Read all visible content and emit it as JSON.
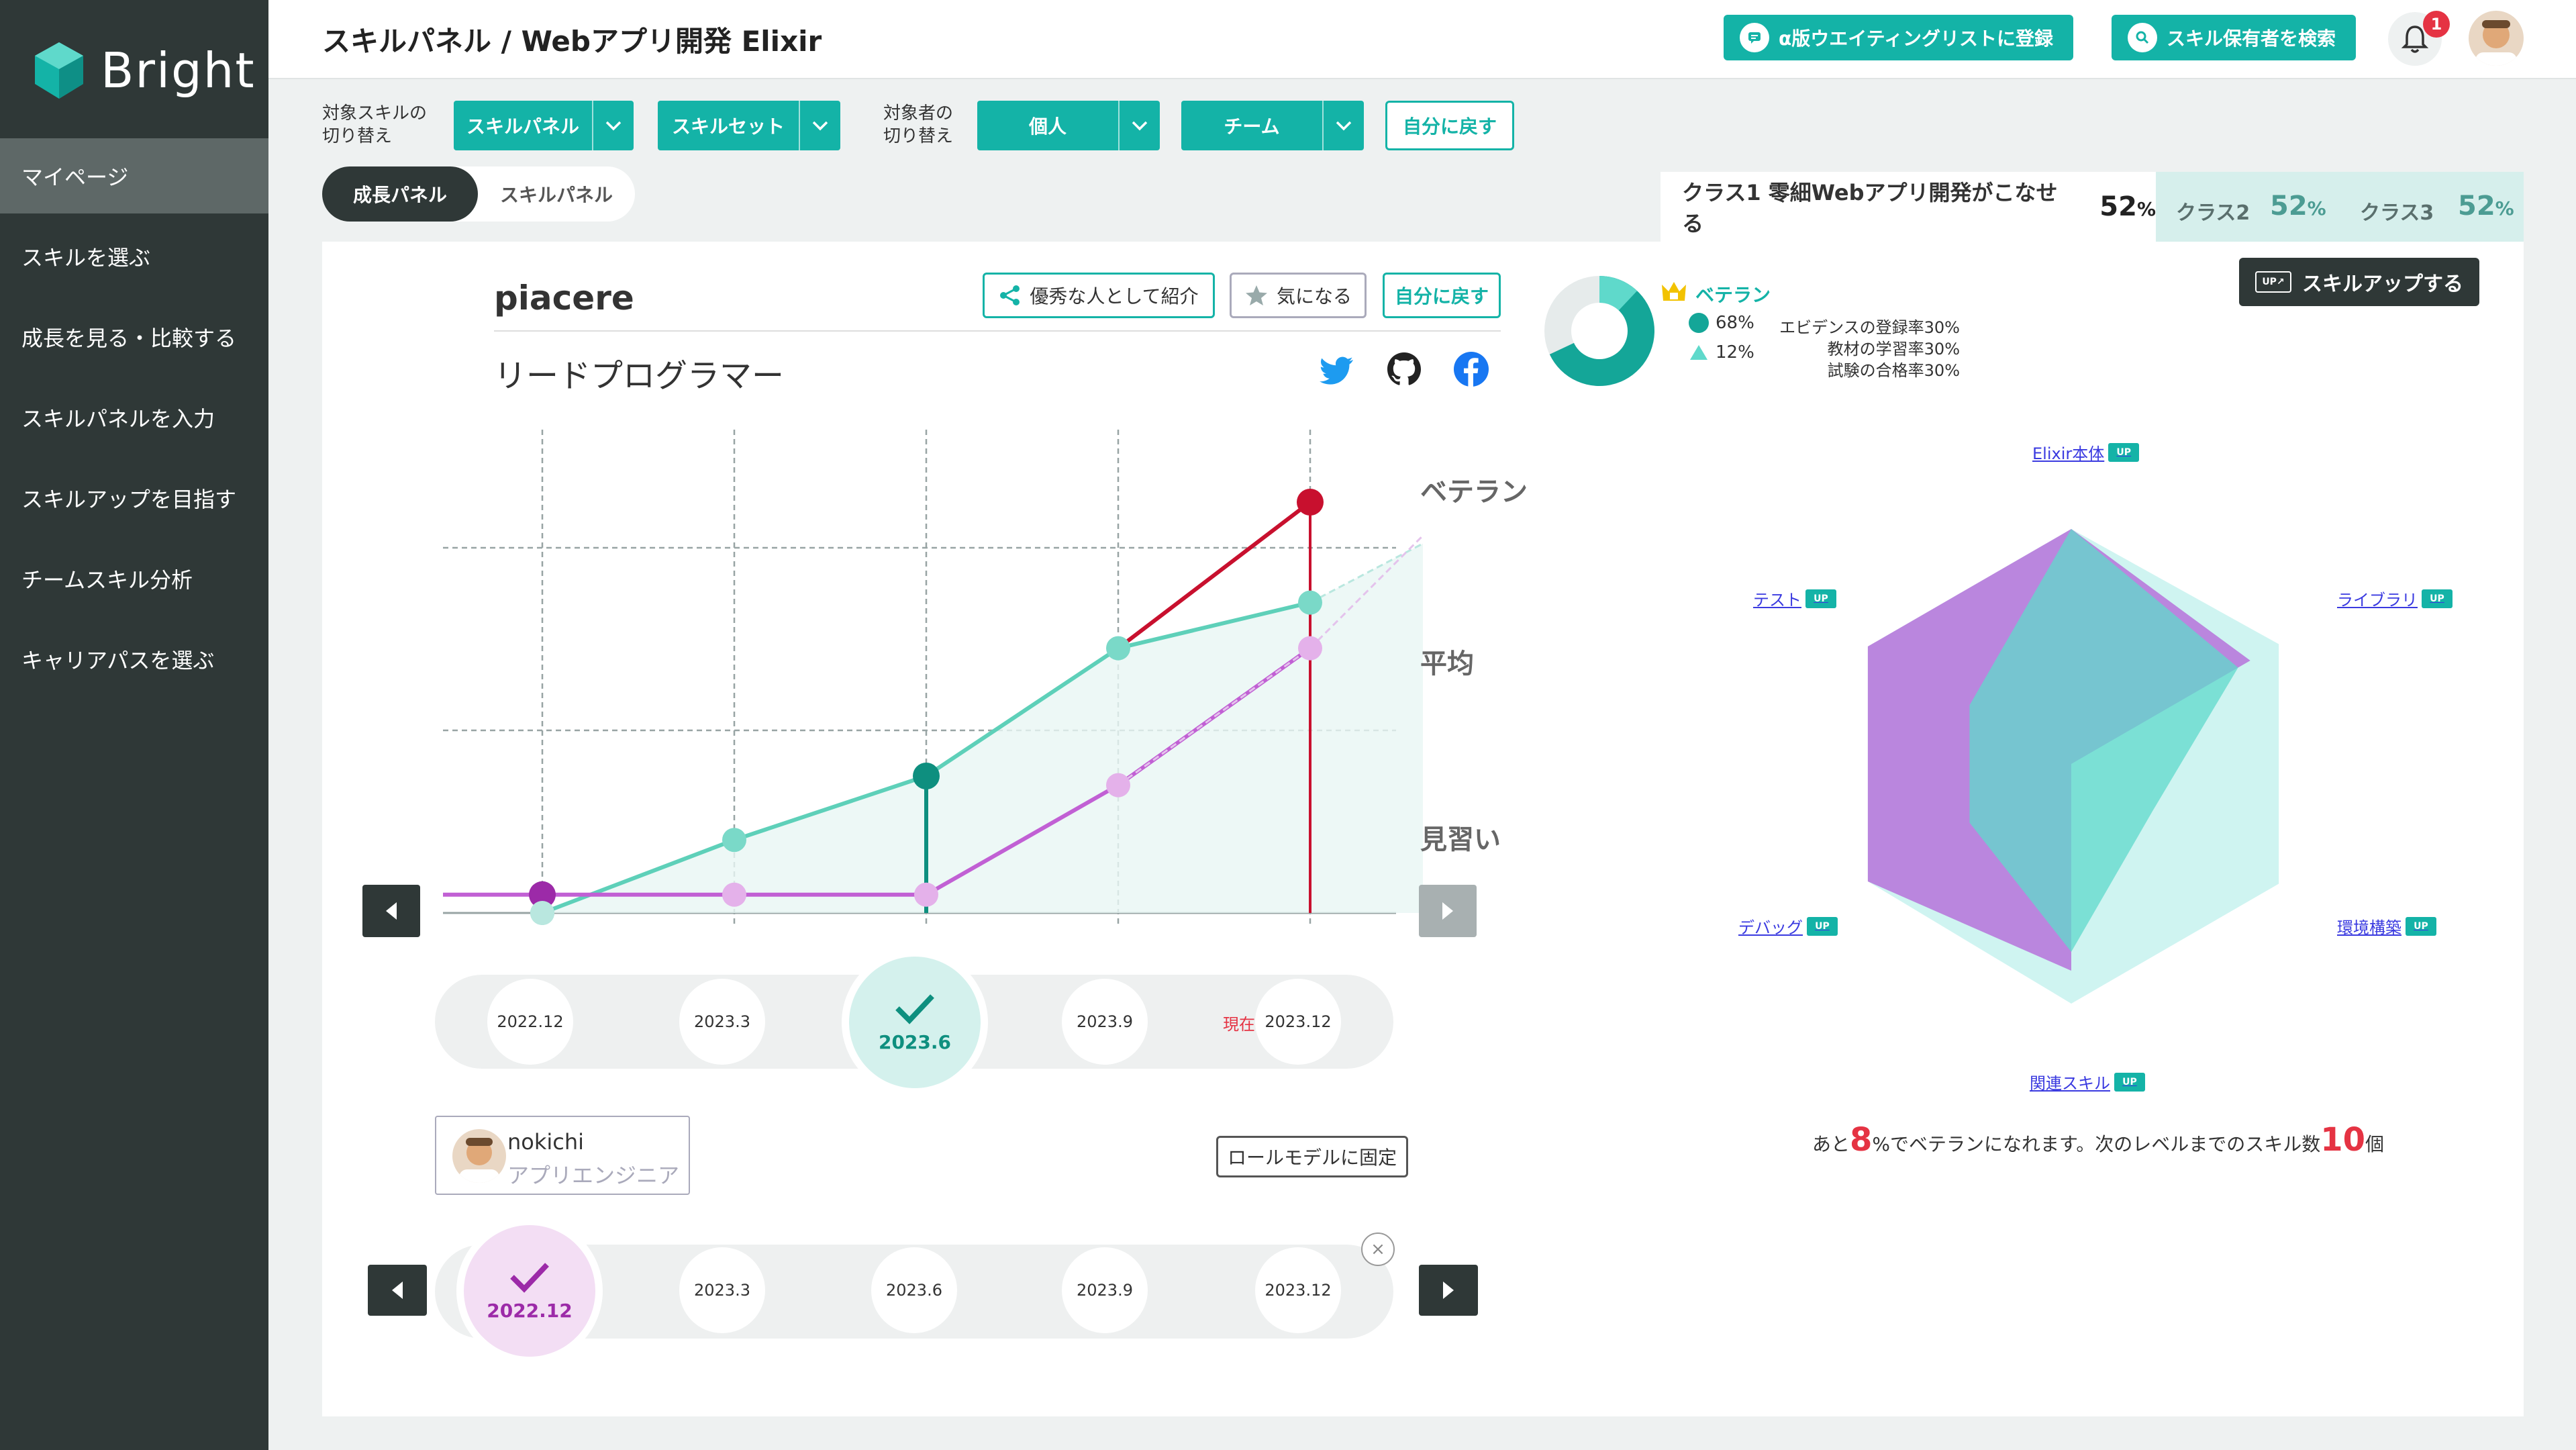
{
  "brand": {
    "logo_text": "Bright"
  },
  "sidebar": {
    "items": [
      {
        "label": "マイページ",
        "active": true
      },
      {
        "label": "スキルを選ぶ"
      },
      {
        "label": "成長を見る・比較する"
      },
      {
        "label": "スキルパネルを入力"
      },
      {
        "label": "スキルアップを目指す"
      },
      {
        "label": "チームスキル分析"
      },
      {
        "label": "キャリアパスを選ぶ"
      }
    ]
  },
  "header": {
    "title": "スキルパネル / Webアプリ開発 Elixir",
    "waitlist_button": "α版ウエイティングリストに登録",
    "search_button": "スキル保有者を検索",
    "notification_count": "1"
  },
  "filters": {
    "skill_switch_label_1": "対象スキルの",
    "skill_switch_label_2": "切り替え",
    "skill_panel_dropdown": "スキルパネル",
    "skill_set_dropdown": "スキルセット",
    "target_label_1": "対象者の",
    "target_label_2": "切り替え",
    "individual_dropdown": "個人",
    "team_dropdown": "チーム",
    "back_to_self": "自分に戻す"
  },
  "toggle": {
    "growth_panel": "成長パネル",
    "skill_panel": "スキルパネル"
  },
  "class_tabs": [
    {
      "label": "クラス1 零細Webアプリ開発がこなせる",
      "pct": "52",
      "unit": "%"
    },
    {
      "label": "クラス2",
      "pct": "52",
      "unit": "%"
    },
    {
      "label": "クラス3",
      "pct": "52",
      "unit": "%"
    }
  ],
  "profile": {
    "name": "piacere",
    "role": "リードプログラマー",
    "introduce_button": "優秀な人として紹介",
    "interested_button": "気になる",
    "back_to_self": "自分に戻す"
  },
  "social_icons": [
    "twitter-icon",
    "github-icon",
    "facebook-icon"
  ],
  "growth_levels": [
    "ベテラン",
    "平均",
    "見習い"
  ],
  "growth_chart_data": {
    "type": "line",
    "x": [
      "2022.12",
      "2023.3",
      "2023.6",
      "2023.9",
      "2023.12",
      "future"
    ],
    "series": [
      {
        "name": "self",
        "values": [
          0,
          0.8,
          1.5,
          2.9,
          3.4,
          null
        ],
        "color": "#5ed0b9"
      },
      {
        "name": "self-current",
        "values": [
          null,
          null,
          null,
          2.9,
          4.5,
          null
        ],
        "color": "#c8102e"
      },
      {
        "name": "self-future",
        "values": [
          null,
          null,
          null,
          null,
          3.4,
          4.5
        ],
        "color": "#b9e7df"
      },
      {
        "name": "compare",
        "values": [
          0.2,
          0.2,
          0.2,
          1.4,
          2.9,
          null
        ],
        "color": "#c160d4"
      },
      {
        "name": "compare-future",
        "values": [
          null,
          null,
          null,
          1.4,
          2.9,
          5.0
        ],
        "color": "#e4c3ec"
      }
    ],
    "ylim": [
      0,
      5
    ]
  },
  "timeline_main": {
    "dates": [
      "2022.12",
      "2023.3",
      "2023.6",
      "2023.9",
      "2023.12"
    ],
    "selected": "2023.6",
    "now_label": "現在"
  },
  "compare": {
    "user_name": "nokichi",
    "user_role": "アプリエンジニア",
    "pin_button": "ロールモデルに固定",
    "close_icon": "×",
    "dates": [
      "2022.12",
      "2023.3",
      "2023.6",
      "2023.9",
      "2023.12"
    ],
    "selected": "2022.12"
  },
  "right_panel": {
    "level": "ベテラン",
    "legend_1": "68%",
    "legend_2": "12%",
    "evidence_1": "エビデンスの登録率30%",
    "evidence_2": "教材の学習率30%",
    "evidence_3": "試験の合格率30%",
    "skill_up_button": "スキルアップする",
    "up_tag": "UP",
    "donut_value": 68,
    "donut_inner_value": 12
  },
  "radar": {
    "axes": [
      "Elixir本体",
      "ライブラリ",
      "環境構築",
      "関連スキル",
      "デバッグ",
      "テスト"
    ],
    "series": [
      {
        "name": "self",
        "values": [
          100,
          82,
          40,
          80,
          50,
          50
        ],
        "color": "#5fd9cb"
      },
      {
        "name": "compare",
        "values": [
          100,
          88,
          0,
          88,
          100,
          100
        ],
        "color": "#b057d6"
      },
      {
        "name": "future",
        "values": [
          100,
          102,
          102,
          102,
          100,
          100
        ],
        "color": "#bff0ec"
      }
    ],
    "max": 100
  },
  "bottom_message": {
    "prefix": "あと",
    "pct": "8",
    "middle": "%でベテランになれます。次のレベルまでのスキル数",
    "count": "10",
    "suffix": "個"
  }
}
